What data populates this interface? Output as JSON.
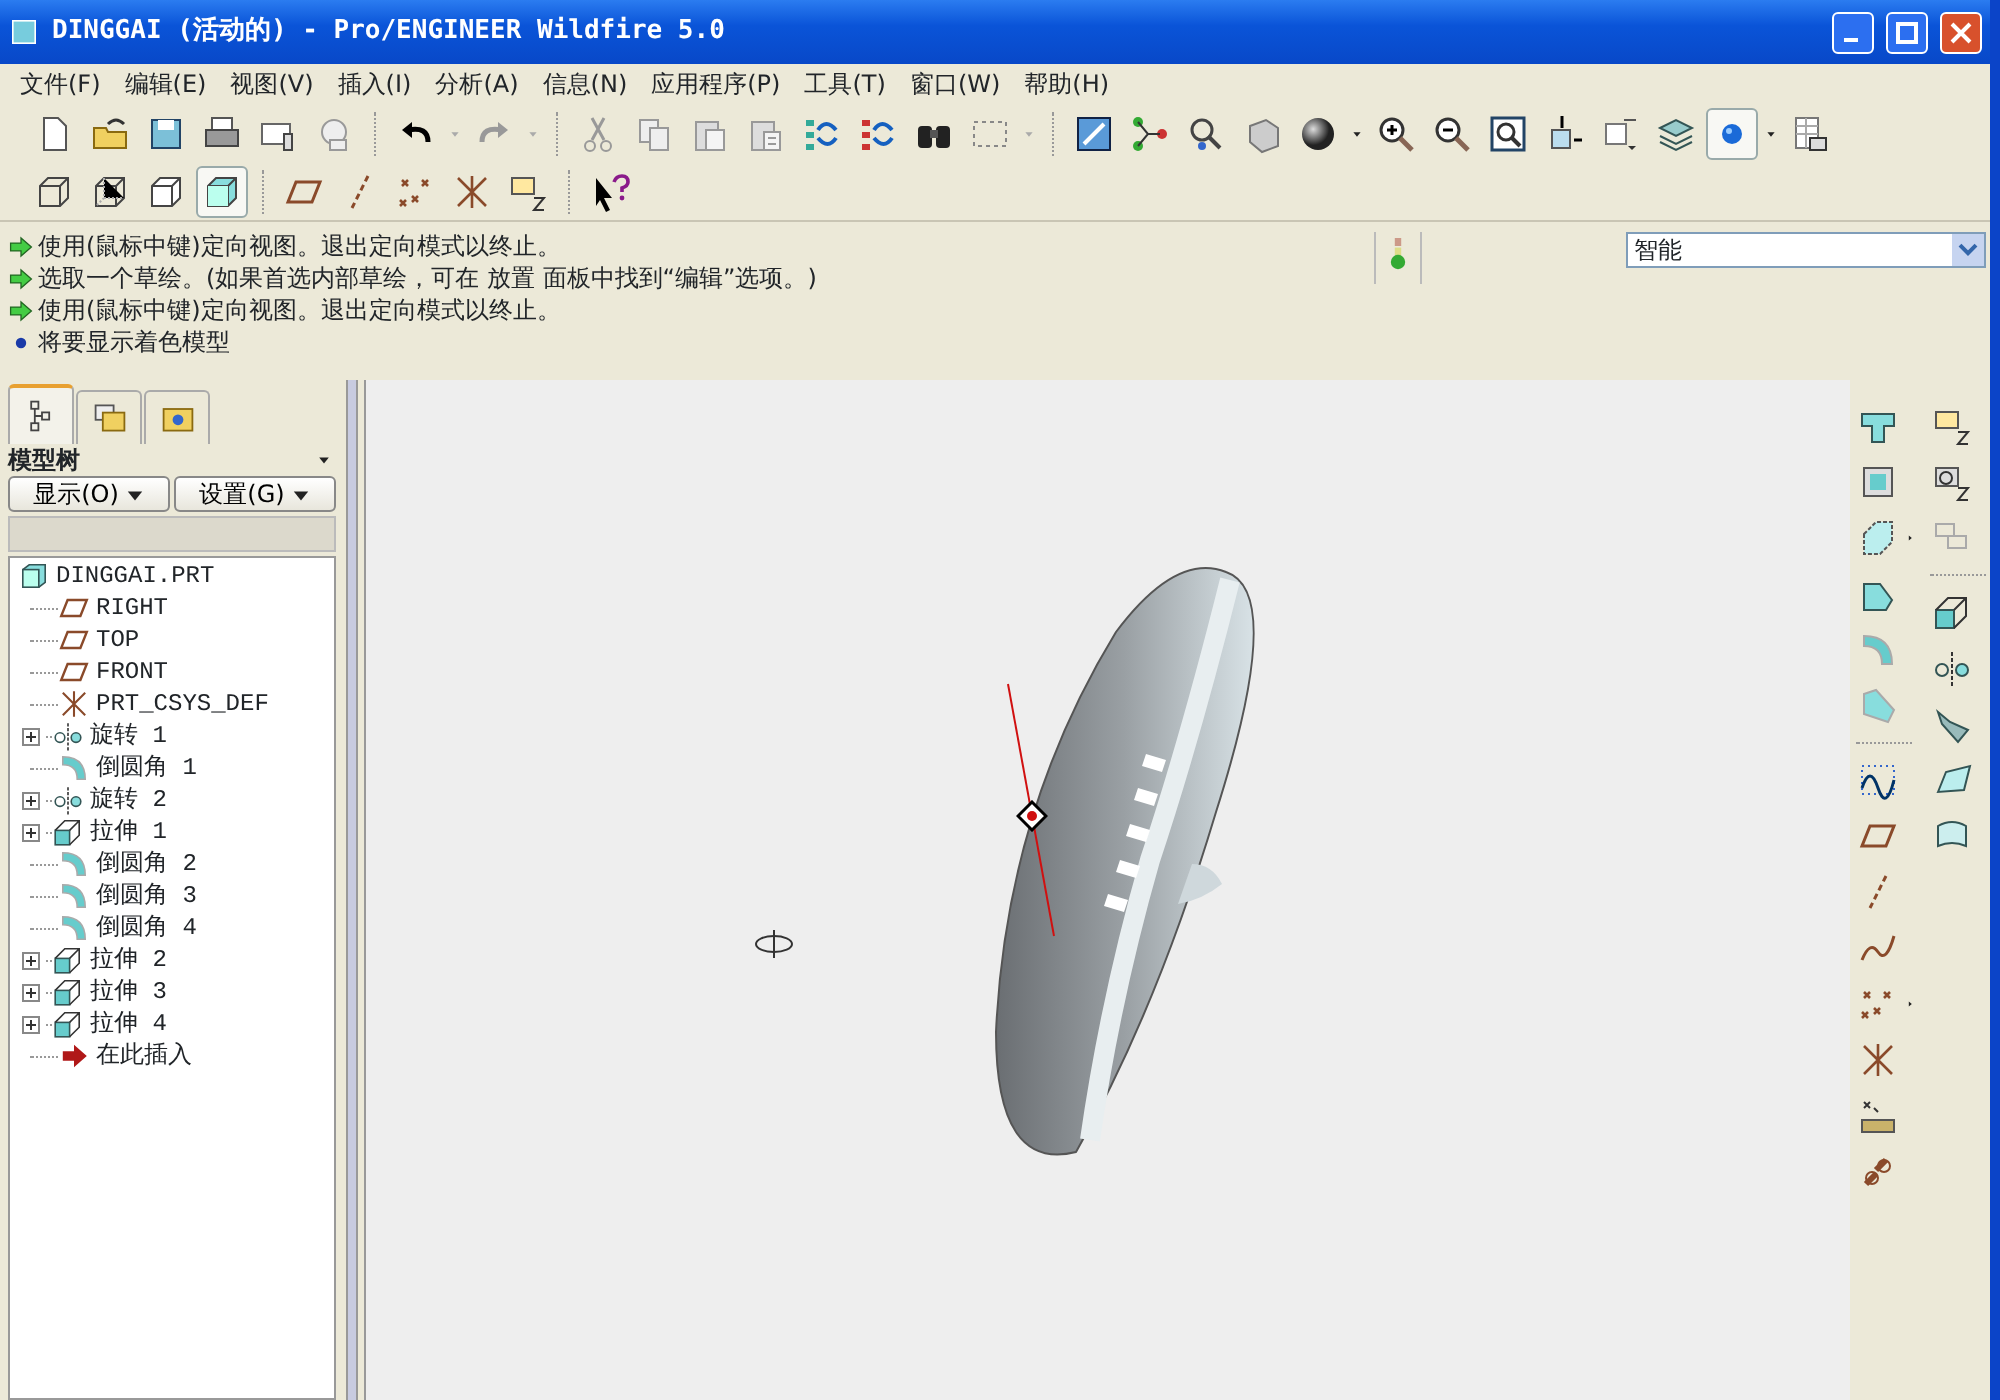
{
  "window": {
    "title": "DINGGAI (活动的) - Pro/ENGINEER Wildfire 5.0"
  },
  "menu": [
    "文件(F)",
    "编辑(E)",
    "视图(V)",
    "插入(I)",
    "分析(A)",
    "信息(N)",
    "应用程序(P)",
    "工具(T)",
    "窗口(W)",
    "帮助(H)"
  ],
  "messages": [
    {
      "kind": "arrow",
      "text": "使用(鼠标中键)定向视图。退出定向模式以终止。"
    },
    {
      "kind": "arrow",
      "text": "选取一个草绘。(如果首选内部草绘，可在 放置 面板中找到“编辑”选项。)"
    },
    {
      "kind": "arrow",
      "text": "使用(鼠标中键)定向视图。退出定向模式以终止。"
    },
    {
      "kind": "bullet",
      "text": "将要显示着色模型"
    }
  ],
  "filter": {
    "value": "智能"
  },
  "model_tree": {
    "tabs": [
      {
        "kind": "tree",
        "selected": true
      },
      {
        "kind": "folders",
        "selected": false
      },
      {
        "kind": "favorites",
        "selected": false
      }
    ],
    "title": "模型树",
    "buttons": [
      "显示(O)",
      "设置(G)"
    ],
    "items": [
      {
        "kind": "part",
        "label": "DINGGAI.PRT",
        "children": [
          {
            "kind": "plane",
            "label": "RIGHT",
            "expandable": false
          },
          {
            "kind": "plane",
            "label": "TOP",
            "expandable": false
          },
          {
            "kind": "plane",
            "label": "FRONT",
            "expandable": false
          },
          {
            "kind": "csys",
            "label": "PRT_CSYS_DEF",
            "expandable": false
          },
          {
            "kind": "revolve",
            "label": "旋转 1",
            "expandable": true
          },
          {
            "kind": "round",
            "label": "倒圆角 1",
            "expandable": false
          },
          {
            "kind": "revolve",
            "label": "旋转 2",
            "expandable": true
          },
          {
            "kind": "extrude",
            "label": "拉伸 1",
            "expandable": true
          },
          {
            "kind": "round",
            "label": "倒圆角 2",
            "expandable": false
          },
          {
            "kind": "round",
            "label": "倒圆角 3",
            "expandable": false
          },
          {
            "kind": "round",
            "label": "倒圆角 4",
            "expandable": false
          },
          {
            "kind": "extrude",
            "label": "拉伸 2",
            "expandable": true
          },
          {
            "kind": "extrude",
            "label": "拉伸 3",
            "expandable": true
          },
          {
            "kind": "extrude",
            "label": "拉伸 4",
            "expandable": true
          },
          {
            "kind": "insert",
            "label": "在此插入",
            "expandable": false
          }
        ]
      }
    ]
  }
}
